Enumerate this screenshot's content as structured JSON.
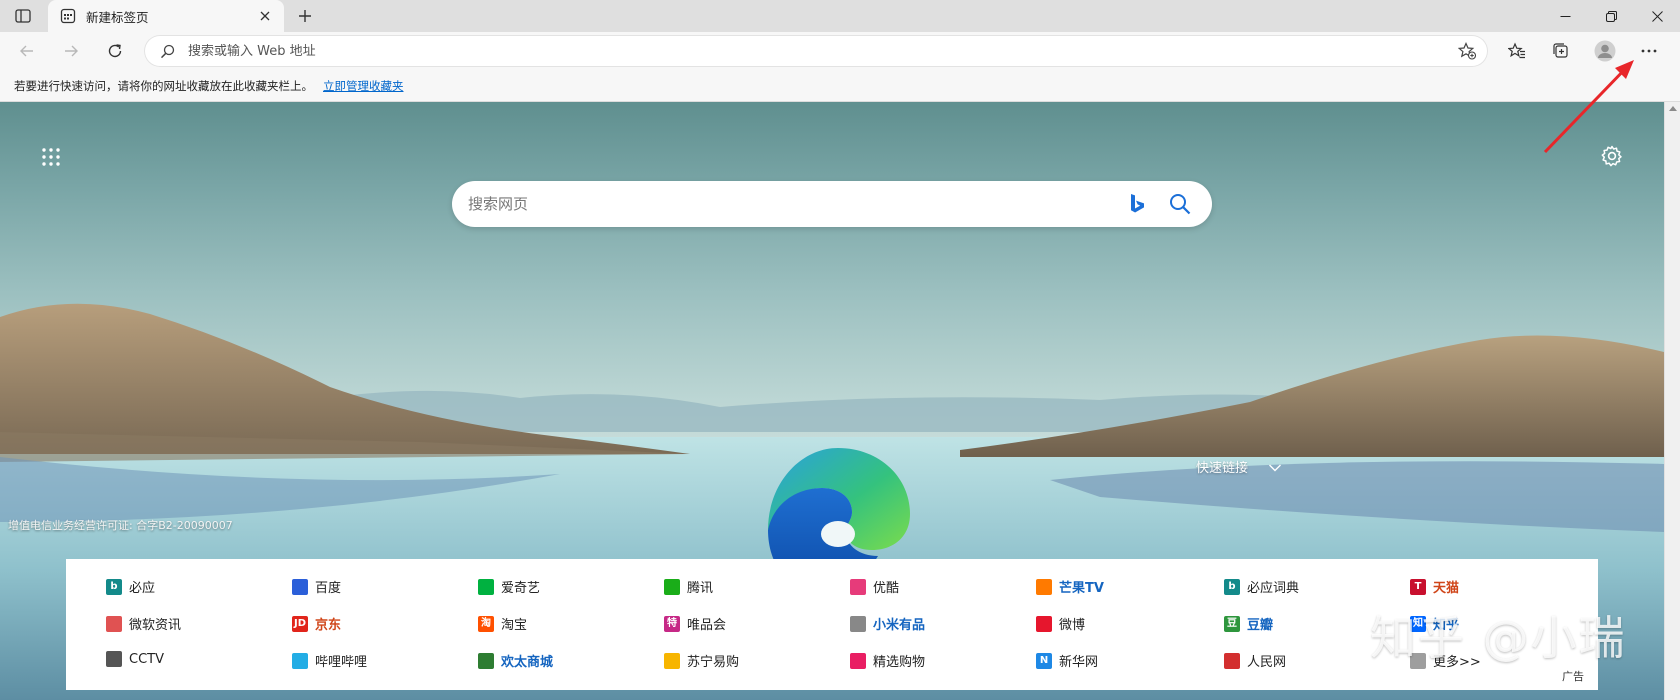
{
  "tab": {
    "title": "新建标签页",
    "favicon": "newtab-icon"
  },
  "toolbar": {
    "address_placeholder": "搜索或输入 Web 地址"
  },
  "favbar": {
    "hint": "若要进行快速访问，请将你的网址收藏放在此收藏夹栏上。",
    "link": "立即管理收藏夹"
  },
  "ntp": {
    "search_placeholder": "搜索网页",
    "quick_links": "快速链接",
    "license": "增值电信业务经营许可证: 合字B2-20090007",
    "ad_label": "广告",
    "watermark": "知乎 @小瑞"
  },
  "links": [
    {
      "label": "必应",
      "icon": "bing-icon",
      "color": "#138a8a",
      "glyph": "b",
      "style": ""
    },
    {
      "label": "百度",
      "icon": "baidu-paw-icon",
      "color": "#2b5fd9",
      "glyph": "",
      "style": ""
    },
    {
      "label": "爱奇艺",
      "icon": "iqiyi-icon",
      "color": "#00b140",
      "glyph": "",
      "style": ""
    },
    {
      "label": "腾讯",
      "icon": "tencent-icon",
      "color": "#1aad19",
      "glyph": "",
      "style": ""
    },
    {
      "label": "优酷",
      "icon": "youku-icon",
      "color": "#e63b7a",
      "glyph": "",
      "style": ""
    },
    {
      "label": "芒果TV",
      "icon": "mangotv-icon",
      "color": "#ff7a00",
      "glyph": "",
      "style": "bold-blue"
    },
    {
      "label": "必应词典",
      "icon": "bing-dict-icon",
      "color": "#138a8a",
      "glyph": "b",
      "style": ""
    },
    {
      "label": "天猫",
      "icon": "tmall-icon",
      "color": "#c8102e",
      "glyph": "T",
      "style": "bold-red"
    },
    {
      "label": "微软资讯",
      "icon": "msn-news-icon",
      "color": "#e05252",
      "glyph": "",
      "style": ""
    },
    {
      "label": "京东",
      "icon": "jd-icon",
      "color": "#e1251b",
      "glyph": "JD",
      "style": "bold-red"
    },
    {
      "label": "淘宝",
      "icon": "taobao-icon",
      "color": "#ff5000",
      "glyph": "淘",
      "style": ""
    },
    {
      "label": "唯品会",
      "icon": "vip-icon",
      "color": "#c62886",
      "glyph": "特",
      "style": ""
    },
    {
      "label": "小米有品",
      "icon": "youpin-icon",
      "color": "#888888",
      "glyph": "",
      "style": "bold-blue"
    },
    {
      "label": "微博",
      "icon": "weibo-icon",
      "color": "#e6162d",
      "glyph": "",
      "style": ""
    },
    {
      "label": "豆瓣",
      "icon": "douban-icon",
      "color": "#2e963d",
      "glyph": "豆",
      "style": "bold-blue"
    },
    {
      "label": "知乎",
      "icon": "zhihu-icon",
      "color": "#0066ff",
      "glyph": "知",
      "style": "bold-blue"
    },
    {
      "label": "CCTV",
      "icon": "cctv-icon",
      "color": "#555555",
      "glyph": "",
      "style": ""
    },
    {
      "label": "哔哩哔哩",
      "icon": "bilibili-icon",
      "color": "#23ade5",
      "glyph": "",
      "style": ""
    },
    {
      "label": "欢太商城",
      "icon": "heytap-icon",
      "color": "#2e7d32",
      "glyph": "",
      "style": "bold-blue"
    },
    {
      "label": "苏宁易购",
      "icon": "suning-icon",
      "color": "#f7b500",
      "glyph": "",
      "style": ""
    },
    {
      "label": "精选购物",
      "icon": "shopping-icon",
      "color": "#e91e63",
      "glyph": "",
      "style": ""
    },
    {
      "label": "新华网",
      "icon": "xinhua-icon",
      "color": "#1e88e5",
      "glyph": "N",
      "style": ""
    },
    {
      "label": "人民网",
      "icon": "people-icon",
      "color": "#d32f2f",
      "glyph": "",
      "style": ""
    },
    {
      "label": "更多>>",
      "icon": "more-icon",
      "color": "#9e9e9e",
      "glyph": "",
      "style": ""
    }
  ]
}
